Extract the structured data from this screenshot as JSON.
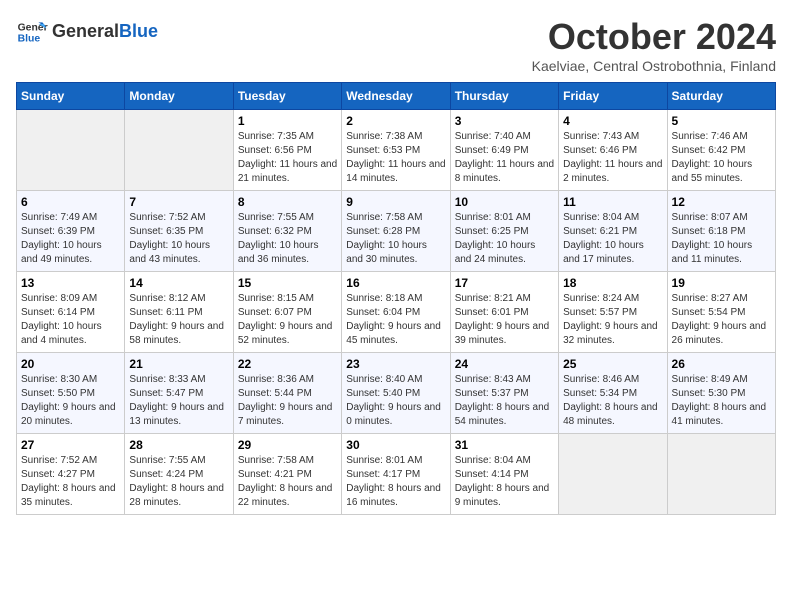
{
  "header": {
    "logo_general": "General",
    "logo_blue": "Blue",
    "month_title": "October 2024",
    "location": "Kaelviae, Central Ostrobothnia, Finland"
  },
  "days_of_week": [
    "Sunday",
    "Monday",
    "Tuesday",
    "Wednesday",
    "Thursday",
    "Friday",
    "Saturday"
  ],
  "weeks": [
    [
      {
        "day": "",
        "info": ""
      },
      {
        "day": "",
        "info": ""
      },
      {
        "day": "1",
        "info": "Sunrise: 7:35 AM\nSunset: 6:56 PM\nDaylight: 11 hours and 21 minutes."
      },
      {
        "day": "2",
        "info": "Sunrise: 7:38 AM\nSunset: 6:53 PM\nDaylight: 11 hours and 14 minutes."
      },
      {
        "day": "3",
        "info": "Sunrise: 7:40 AM\nSunset: 6:49 PM\nDaylight: 11 hours and 8 minutes."
      },
      {
        "day": "4",
        "info": "Sunrise: 7:43 AM\nSunset: 6:46 PM\nDaylight: 11 hours and 2 minutes."
      },
      {
        "day": "5",
        "info": "Sunrise: 7:46 AM\nSunset: 6:42 PM\nDaylight: 10 hours and 55 minutes."
      }
    ],
    [
      {
        "day": "6",
        "info": "Sunrise: 7:49 AM\nSunset: 6:39 PM\nDaylight: 10 hours and 49 minutes."
      },
      {
        "day": "7",
        "info": "Sunrise: 7:52 AM\nSunset: 6:35 PM\nDaylight: 10 hours and 43 minutes."
      },
      {
        "day": "8",
        "info": "Sunrise: 7:55 AM\nSunset: 6:32 PM\nDaylight: 10 hours and 36 minutes."
      },
      {
        "day": "9",
        "info": "Sunrise: 7:58 AM\nSunset: 6:28 PM\nDaylight: 10 hours and 30 minutes."
      },
      {
        "day": "10",
        "info": "Sunrise: 8:01 AM\nSunset: 6:25 PM\nDaylight: 10 hours and 24 minutes."
      },
      {
        "day": "11",
        "info": "Sunrise: 8:04 AM\nSunset: 6:21 PM\nDaylight: 10 hours and 17 minutes."
      },
      {
        "day": "12",
        "info": "Sunrise: 8:07 AM\nSunset: 6:18 PM\nDaylight: 10 hours and 11 minutes."
      }
    ],
    [
      {
        "day": "13",
        "info": "Sunrise: 8:09 AM\nSunset: 6:14 PM\nDaylight: 10 hours and 4 minutes."
      },
      {
        "day": "14",
        "info": "Sunrise: 8:12 AM\nSunset: 6:11 PM\nDaylight: 9 hours and 58 minutes."
      },
      {
        "day": "15",
        "info": "Sunrise: 8:15 AM\nSunset: 6:07 PM\nDaylight: 9 hours and 52 minutes."
      },
      {
        "day": "16",
        "info": "Sunrise: 8:18 AM\nSunset: 6:04 PM\nDaylight: 9 hours and 45 minutes."
      },
      {
        "day": "17",
        "info": "Sunrise: 8:21 AM\nSunset: 6:01 PM\nDaylight: 9 hours and 39 minutes."
      },
      {
        "day": "18",
        "info": "Sunrise: 8:24 AM\nSunset: 5:57 PM\nDaylight: 9 hours and 32 minutes."
      },
      {
        "day": "19",
        "info": "Sunrise: 8:27 AM\nSunset: 5:54 PM\nDaylight: 9 hours and 26 minutes."
      }
    ],
    [
      {
        "day": "20",
        "info": "Sunrise: 8:30 AM\nSunset: 5:50 PM\nDaylight: 9 hours and 20 minutes."
      },
      {
        "day": "21",
        "info": "Sunrise: 8:33 AM\nSunset: 5:47 PM\nDaylight: 9 hours and 13 minutes."
      },
      {
        "day": "22",
        "info": "Sunrise: 8:36 AM\nSunset: 5:44 PM\nDaylight: 9 hours and 7 minutes."
      },
      {
        "day": "23",
        "info": "Sunrise: 8:40 AM\nSunset: 5:40 PM\nDaylight: 9 hours and 0 minutes."
      },
      {
        "day": "24",
        "info": "Sunrise: 8:43 AM\nSunset: 5:37 PM\nDaylight: 8 hours and 54 minutes."
      },
      {
        "day": "25",
        "info": "Sunrise: 8:46 AM\nSunset: 5:34 PM\nDaylight: 8 hours and 48 minutes."
      },
      {
        "day": "26",
        "info": "Sunrise: 8:49 AM\nSunset: 5:30 PM\nDaylight: 8 hours and 41 minutes."
      }
    ],
    [
      {
        "day": "27",
        "info": "Sunrise: 7:52 AM\nSunset: 4:27 PM\nDaylight: 8 hours and 35 minutes."
      },
      {
        "day": "28",
        "info": "Sunrise: 7:55 AM\nSunset: 4:24 PM\nDaylight: 8 hours and 28 minutes."
      },
      {
        "day": "29",
        "info": "Sunrise: 7:58 AM\nSunset: 4:21 PM\nDaylight: 8 hours and 22 minutes."
      },
      {
        "day": "30",
        "info": "Sunrise: 8:01 AM\nSunset: 4:17 PM\nDaylight: 8 hours and 16 minutes."
      },
      {
        "day": "31",
        "info": "Sunrise: 8:04 AM\nSunset: 4:14 PM\nDaylight: 8 hours and 9 minutes."
      },
      {
        "day": "",
        "info": ""
      },
      {
        "day": "",
        "info": ""
      }
    ]
  ]
}
